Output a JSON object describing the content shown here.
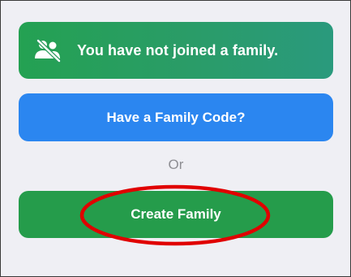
{
  "banner": {
    "icon": "people-slash-icon",
    "text": "You have not joined a family."
  },
  "buttons": {
    "family_code_label": "Have a Family Code?",
    "create_family_label": "Create Family"
  },
  "separator_text": "Or",
  "colors": {
    "banner_green": "#24a152",
    "code_button_blue": "#2b86f0",
    "create_button_green": "#259c4b",
    "annotation_red": "#e00000",
    "background": "#efeff4"
  }
}
